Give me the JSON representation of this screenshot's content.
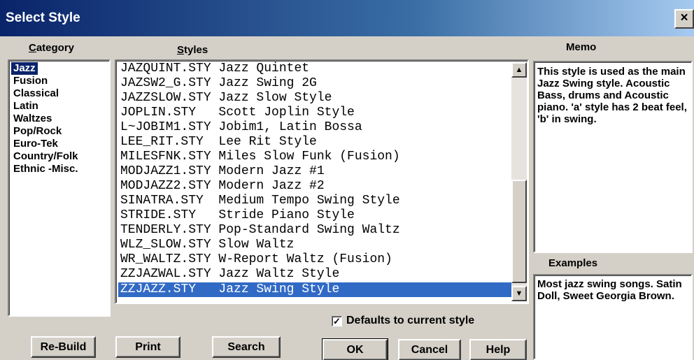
{
  "window": {
    "title": "Select Style",
    "close_label": "×"
  },
  "category": {
    "label_underlined": "C",
    "label_rest": "ategory",
    "items": [
      "Jazz",
      "Fusion",
      "Classical",
      "Latin",
      "Waltzes",
      "Pop/Rock",
      "Euro-Tek",
      "Country/Folk",
      "Ethnic -Misc."
    ],
    "selected": "Jazz"
  },
  "styles": {
    "label_underlined": "S",
    "label_rest": "tyles",
    "rows": [
      "JAZQUINT.STY Jazz Quintet",
      "JAZSW2_G.STY Jazz Swing 2G",
      "JAZZSLOW.STY Jazz Slow Style",
      "JOPLIN.STY   Scott Joplin Style",
      "L~JOBIM1.STY Jobim1, Latin Bossa",
      "LEE_RIT.STY  Lee Rit Style",
      "MILESFNK.STY Miles Slow Funk (Fusion)",
      "MODJAZZ1.STY Modern Jazz #1",
      "MODJAZZ2.STY Modern Jazz #2",
      "SINATRA.STY  Medium Tempo Swing Style",
      "STRIDE.STY   Stride Piano Style",
      "TENDERLY.STY Pop-Standard Swing Waltz",
      "WLZ_SLOW.STY Slow Waltz",
      "WR_WALTZ.STY W-Report Waltz (Fusion)",
      "ZZJAZWAL.STY Jazz Waltz Style",
      "ZZJAZZ.STY   Jazz Swing Style"
    ],
    "selected_index": 15
  },
  "memo": {
    "label": "Memo",
    "text": "This style is used as the main Jazz Swing style.  Acoustic Bass, drums and Acoustic piano. 'a' style has 2 beat feel, 'b' in swing."
  },
  "examples": {
    "label": "Examples",
    "text": "Most jazz swing songs. Satin Doll, Sweet Georgia Brown."
  },
  "defaults_checkbox": {
    "label": "Defaults to current style",
    "checked": true,
    "mark": "✓"
  },
  "buttons": {
    "rebuild": "Re-Build",
    "print": "Print",
    "search": "Search",
    "ok": "OK",
    "cancel": "Cancel",
    "help": "Help"
  },
  "scroll": {
    "up_arrow": "▲",
    "down_arrow": "▼"
  },
  "colors": {
    "title_bar": "#0a246a",
    "selection": "#316ac5",
    "dialog_bg": "#d4d0c8"
  }
}
